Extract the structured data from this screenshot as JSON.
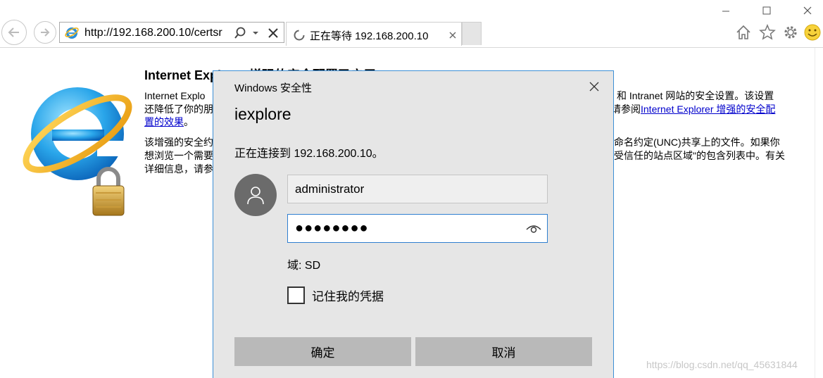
{
  "browser": {
    "address_url": "http://192.168.200.10/certsr",
    "tab_title": "正在等待 192.168.200.10"
  },
  "page": {
    "title": "Internet Explorer 增强的安全配置已启用",
    "para1_line1": "Internet Explo",
    "para1_line1_right": "和 Intranet 网站的安全设置。该设置",
    "para1_line2": "还降低了你的朋",
    "para1_line2_right": "请参阅",
    "para1_link_a": "Internet Explorer 增强的安全配",
    "para1_link_b": "置的效果",
    "para1_end": "。",
    "para2_line1": "该增强的安全约",
    "para2_line1_right": "命名约定(UNC)共享上的文件。如果你",
    "para2_line2": "想浏览一个需要",
    "para2_line2_right": "受信任的站点区域\"的包含列表中。有关",
    "para2_line3": "详细信息，请参"
  },
  "dialog": {
    "caption": "Windows 安全性",
    "app_name": "iexplore",
    "message": "正在连接到 192.168.200.10。",
    "username": "administrator",
    "password_mask": "●●●●●●●●",
    "domain_label": "域: SD",
    "remember_label": "记住我的凭据",
    "ok_label": "确定",
    "cancel_label": "取消"
  },
  "watermark": "https://blog.csdn.net/qq_45631844",
  "colors": {
    "dialog_bg": "#e6e6e6",
    "dialog_border": "#3c8fd6",
    "button_bg": "#b9b9b9",
    "avatar_bg": "#6b6b6b",
    "link": "#0000cc"
  }
}
